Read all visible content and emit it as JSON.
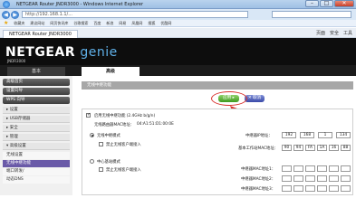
{
  "window": {
    "title": "NETGEAR Router JNDR3000 - Windows Internet Explorer",
    "buttons": {
      "minimize": "–",
      "maximize": "□",
      "close": "✕"
    }
  },
  "browser": {
    "url": "http://192.168.1.1/...",
    "search_placeholder": "",
    "favorites": [
      "收藏夹",
      "建议网站",
      "网页快讯库",
      "谷歌搜索",
      "百度",
      "新浪",
      "网易",
      "凤凰网",
      "搜狐",
      "优酷网"
    ],
    "tab": "NETGEAR Router JNDR3000",
    "tools": [
      "页面",
      "安全",
      "工具"
    ]
  },
  "banner": {
    "brand": "NETGEAR",
    "product": "genie",
    "model": "JNDR3000"
  },
  "main_tabs": {
    "basic": "基本",
    "advanced": "高级"
  },
  "sidebar": {
    "items": [
      {
        "label": "高级首页"
      },
      {
        "label": "设置向导"
      },
      {
        "label": "WPS 向导"
      },
      {
        "label": "▸ 设置"
      },
      {
        "label": "▸ USB存储器"
      },
      {
        "label": "▸ 安全"
      },
      {
        "label": "▸ 管理"
      },
      {
        "label": "▾ 高级设置"
      },
      {
        "label": "无线设置"
      },
      {
        "label": "无线中继功能"
      },
      {
        "label": "端口转发/"
      },
      {
        "label": "动态DNS"
      }
    ]
  },
  "panel": {
    "title": "无线中继功能",
    "apply_label": "应用 ▸",
    "cancel_label": "✕ 取消",
    "enable_repeater": "启用无线中继功能 (2.4GHz b/g/n)",
    "wireless_mac_label": "无线路由器MAC地址：",
    "wireless_mac": "04:A1:51:D1:00:0E",
    "repeater_mode": "无线中继模式",
    "disable_client": "禁止无线客户端接入",
    "repeater_ip_label": "中继器IP地址：",
    "repeater_ip": [
      "192",
      "168",
      "1",
      "134"
    ],
    "base_station_mac_label": "基本工作站MAC地址：",
    "base_station_mac": [
      "90",
      "94",
      "FA",
      "1A",
      "16",
      "88"
    ],
    "base_station_mode": "中心基站模式",
    "disable_client_2": "禁止无线客户端接入",
    "repeater_mac_label_1": "中继器MAC地址1：",
    "repeater_mac_label_2": "中继器MAC地址2：",
    "repeater_mac_label_3": "中继器MAC地址3："
  },
  "colors": {
    "highlight_ring": "#d9302c",
    "apply_button": "#4fa82a",
    "active_sidebar": "#6a5aa8"
  }
}
